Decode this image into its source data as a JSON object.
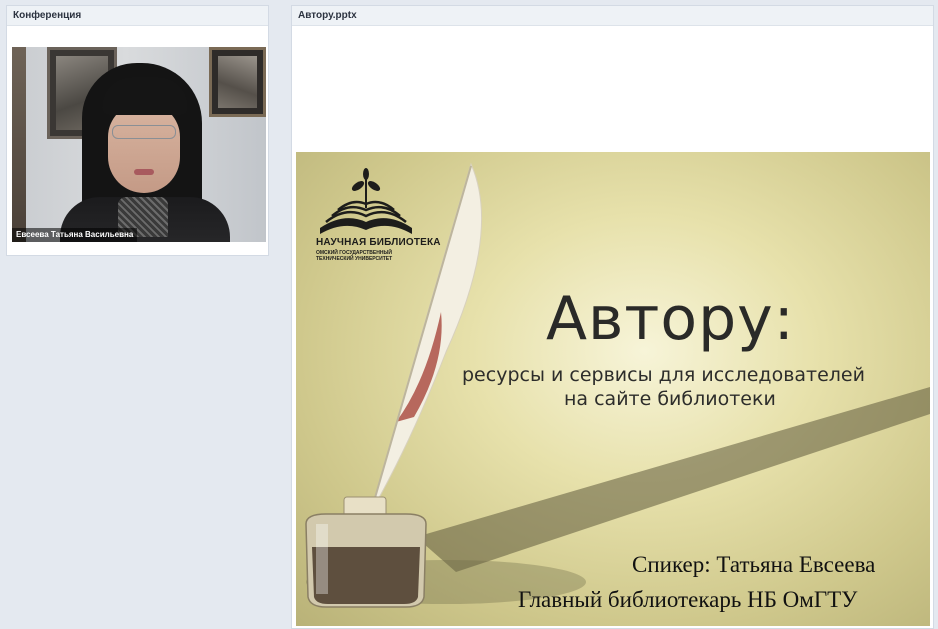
{
  "conference_panel": {
    "title": "Конференция",
    "participant_name": "Евсеева Татьяна Васильевна"
  },
  "presentation_panel": {
    "title": "Автору.pptx",
    "slide": {
      "logo_line1": "НАУЧНАЯ БИБЛИОТЕКА",
      "logo_line2": "ОМСКИЙ ГОСУДАРСТВЕННЫЙ",
      "logo_line3": "ТЕХНИЧЕСКИЙ УНИВЕРСИТЕТ",
      "title": "Автору:",
      "subtitle_line1": "ресурсы и сервисы для исследователей",
      "subtitle_line2": "на сайте библиотеки",
      "speaker": "Спикер: Татьяна Евсеева",
      "role": "Главный библиотекарь НБ ОмГТУ"
    }
  },
  "colors": {
    "background": "#e4e9f0",
    "panel_header": "#eef2f6",
    "slide_gold": "#e7e1ab"
  }
}
